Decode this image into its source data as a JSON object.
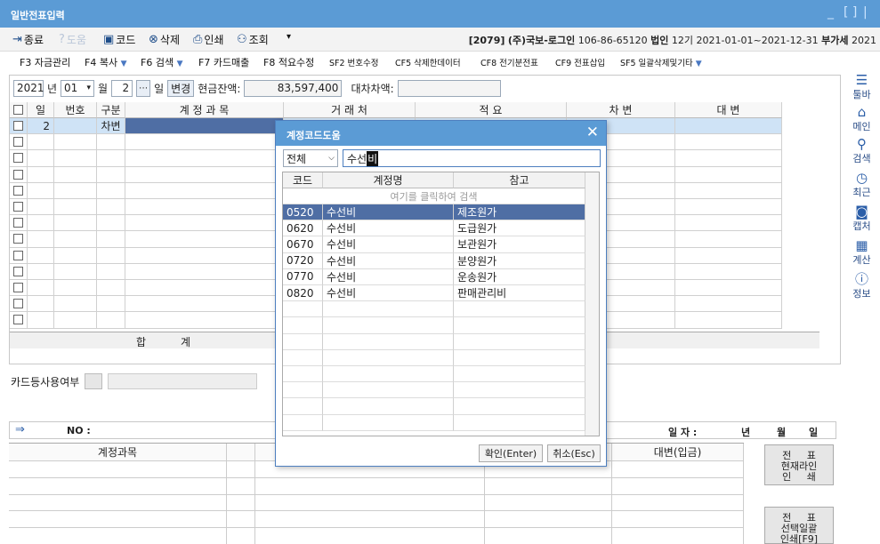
{
  "window": {
    "title": "일반전표입력"
  },
  "toolbar": {
    "close_label": "종료",
    "help_label": "도움",
    "code_label": "코드",
    "delete_label": "삭제",
    "print_label": "인쇄",
    "search_label": "조회",
    "company_code": "[2079]",
    "company_name": "(주)국보-로그인",
    "biz_no": "106-86-65120",
    "entity_label": "법인",
    "period_no": "12기",
    "period": "2021-01-01~2021-12-31",
    "vat_label": "부가세",
    "year_tail": "2021"
  },
  "fkeys": [
    {
      "label": "F3 자금관리"
    },
    {
      "label": "F4 복사",
      "dropdown": true
    },
    {
      "label": "F6 검색",
      "dropdown": true
    },
    {
      "label": "F7 카드매출"
    },
    {
      "label": "F8 적요수정"
    },
    {
      "label": "SF2 번호수정"
    },
    {
      "label": "CF5 삭제한데이터"
    },
    {
      "label": "CF8 전기분전표"
    },
    {
      "label": "CF9 전표삽입"
    },
    {
      "label": "SF5 일괄삭제및기타",
      "dropdown": true
    }
  ],
  "datebar": {
    "year": "2021",
    "year_unit": "년",
    "month": "01",
    "month_unit": "월",
    "day": "2",
    "day_unit": "일",
    "change_label": "변경",
    "cash_label": "현금잔액:",
    "cash_value": "83,597,400",
    "diff_label": "대차차액:"
  },
  "grid": {
    "headers": [
      "일",
      "번호",
      "구분",
      "계 정 과 목",
      "거 래 처",
      "적 요",
      "차 변",
      "대 변"
    ],
    "rows": [
      {
        "day": "2",
        "no": "",
        "type": "차변"
      }
    ],
    "sum_label_1": "합",
    "sum_label_2": "계"
  },
  "card": {
    "label": "카드등사용여부"
  },
  "bottombar": {
    "no_label": "NO :",
    "date_label": "일 자 :",
    "year_unit": "년",
    "month_unit": "월",
    "day_unit": "일"
  },
  "bottomtable": {
    "account_header": "계정과목",
    "credit_header": "대변(입금)"
  },
  "side_buttons": [
    {
      "line1": "전     표",
      "line2": "현재라인",
      "line3": "인     쇄"
    },
    {
      "line1": "전     표",
      "line2": "선택일괄",
      "line3": "인쇄[F9]"
    }
  ],
  "rightbar": [
    {
      "icon": "menu-icon",
      "label": "툴바"
    },
    {
      "icon": "home-icon",
      "label": "메인"
    },
    {
      "icon": "search-icon",
      "label": "검색"
    },
    {
      "icon": "clock-icon",
      "label": "최근"
    },
    {
      "icon": "camera-icon",
      "label": "캡처"
    },
    {
      "icon": "calculator-icon",
      "label": "계산"
    },
    {
      "icon": "info-icon",
      "label": "정보"
    }
  ],
  "dialog": {
    "title": "계정코드도움",
    "filter": "전체",
    "search_value": "수선",
    "search_cursor": "비",
    "headers": [
      "코드",
      "계정명",
      "참고"
    ],
    "search_hint": "여기를 클릭하여 검색",
    "rows": [
      {
        "code": "0520",
        "name": "수선비",
        "ref": "제조원가"
      },
      {
        "code": "0620",
        "name": "수선비",
        "ref": "도급원가"
      },
      {
        "code": "0670",
        "name": "수선비",
        "ref": "보관원가"
      },
      {
        "code": "0720",
        "name": "수선비",
        "ref": "분양원가"
      },
      {
        "code": "0770",
        "name": "수선비",
        "ref": "운송원가"
      },
      {
        "code": "0820",
        "name": "수선비",
        "ref": "판매관리비"
      }
    ],
    "ok_label": "확인(Enter)",
    "cancel_label": "취소(Esc)"
  }
}
